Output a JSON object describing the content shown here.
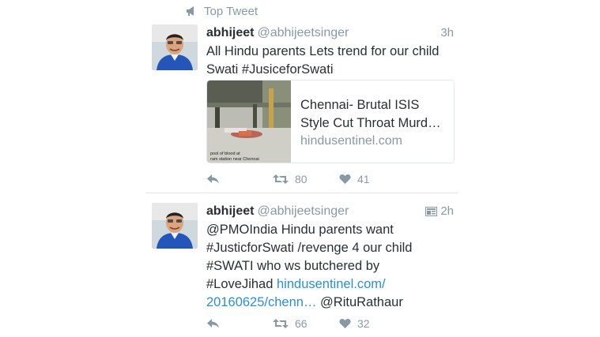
{
  "top_label": "Top Tweet",
  "tweets": [
    {
      "name": "abhijeet",
      "handle": "@abhijeetsinger",
      "time": "3h",
      "text": "All Hindu parents Lets trend for our child Swati #JusiceforSwati",
      "card": {
        "title_line1": "Chennai- Brutal ISIS",
        "title_line2": "Style Cut Throat Murd…",
        "domain": "hindusentinel.com",
        "image_caption_1": "pool of blood at",
        "image_caption_2": "ram station near Chennai"
      },
      "retweets": "80",
      "likes": "41"
    },
    {
      "name": "abhijeet",
      "handle": "@abhijeetsinger",
      "time": "2h",
      "text_line1": "@PMOIndia Hindu parents want",
      "text_line2": "#JusticforSwati /revenge 4 our child",
      "text_line3": "#SWATI who ws butchered by",
      "text_line4_plain": "#LoveJihad ",
      "text_line4_link": "hindusentinel.com/",
      "text_line5_link": "20160625/chenn…",
      "text_line5_plain": " @RituRathaur",
      "retweets": "66",
      "likes": "32"
    }
  ],
  "colors": {
    "link": "#2a8fd6",
    "muted": "#8899a6",
    "text": "#292f33",
    "border": "#e1e8ed"
  },
  "icons": [
    "megaphone-icon",
    "reply-icon",
    "retweet-icon",
    "heart-icon",
    "media-icon"
  ]
}
